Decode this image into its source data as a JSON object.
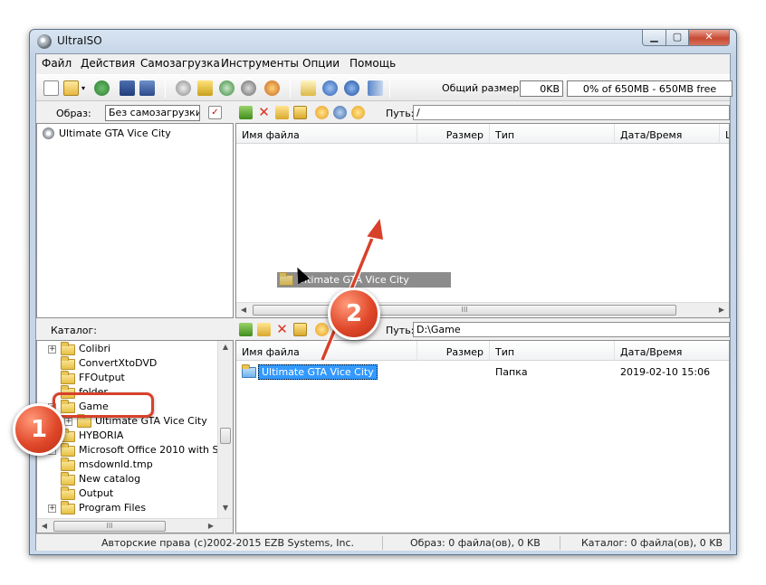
{
  "window": {
    "title": "UltraISO"
  },
  "menu": [
    "Файл",
    "Действия",
    "Самозагрузка",
    "Инструменты",
    "Опции",
    "Помощь"
  ],
  "toolbar": {
    "size_label": "Общий размер:",
    "size_value": "0KB",
    "progress_text": "0% of 650MB - 650MB free",
    "icons": [
      "new-icon",
      "open-icon",
      "dropdown-arrow-icon",
      "extract-icon",
      "save-icon",
      "save-as-icon",
      "mount-icon",
      "burn-icon",
      "compress-icon",
      "virtual-drive-icon",
      "wizard-icon",
      "properties-icon",
      "info-icon",
      "help-icon",
      "exit-icon"
    ]
  },
  "image_panel": {
    "label": "Образ:",
    "boot_value": "Без самозагрузки",
    "root_item": "Ultimate GTA Vice City"
  },
  "upper_panel": {
    "path_label": "Путь:",
    "path_value": "/",
    "columns": [
      "Имя файла",
      "Размер",
      "Тип",
      "Дата/Время",
      "L"
    ],
    "drag_item": "Ultimate GTA Vice City",
    "scroll_thumb_glyph": "III"
  },
  "catalog_panel": {
    "label": "Каталог:",
    "items": [
      {
        "name": "Colibri",
        "expander": "+"
      },
      {
        "name": "ConvertXtoDVD",
        "expander": ""
      },
      {
        "name": "FFOutput",
        "expander": ""
      },
      {
        "name": "folder",
        "expander": ""
      },
      {
        "name": "Game",
        "expander": "−"
      },
      {
        "name": "Ultimate GTA Vice City",
        "expander": "+"
      },
      {
        "name": "HYBORIA",
        "expander": "+"
      },
      {
        "name": "Microsoft Office 2010 with S",
        "expander": "+"
      },
      {
        "name": "msdownld.tmp",
        "expander": ""
      },
      {
        "name": "New catalog",
        "expander": ""
      },
      {
        "name": "Output",
        "expander": ""
      },
      {
        "name": "Program Files",
        "expander": "+"
      }
    ]
  },
  "lower_panel": {
    "path_label": "Путь:",
    "path_value": "D:\\Game",
    "columns": [
      "Имя файла",
      "Размер",
      "Тип",
      "Дата/Время"
    ],
    "rows": [
      {
        "name": "Ultimate GTA Vice City",
        "size": "",
        "type": "Папка",
        "date": "2019-02-10 15:06"
      }
    ]
  },
  "status": {
    "copyright": "Авторские права (c)2002-2015 EZB Systems, Inc.",
    "image_info": "Образ: 0 файла(ов), 0 KB",
    "catalog_info": "Каталог: 0 файла(ов), 0 KB"
  },
  "annotations": {
    "step1": "1",
    "step2": "2",
    "accent": "#e0482a"
  }
}
